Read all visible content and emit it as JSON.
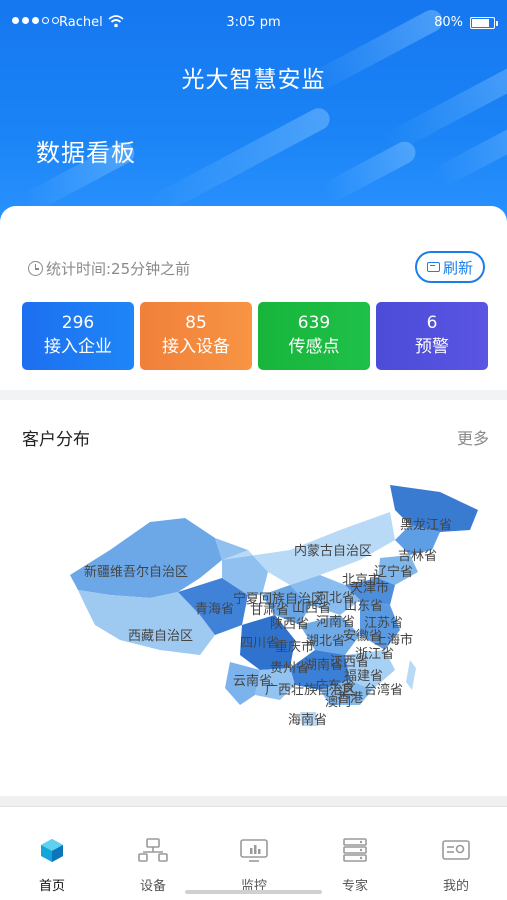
{
  "status_bar": {
    "carrier": "Rachel",
    "time": "3:05 pm",
    "battery": "80%",
    "battery_level": 0.8
  },
  "header": {
    "app_title": "光大智慧安监",
    "dashboard_title": "数据看板"
  },
  "stats": {
    "time_label": "统计时间:25分钟之前",
    "refresh_label": "刷新",
    "tiles": [
      {
        "value": "296",
        "label": "接入企业"
      },
      {
        "value": "85",
        "label": "接入设备"
      },
      {
        "value": "639",
        "label": "传感点"
      },
      {
        "value": "6",
        "label": "预警"
      }
    ]
  },
  "distribution": {
    "title": "客户分布",
    "more": "更多",
    "regions": [
      "黑龙江省",
      "吉林省",
      "辽宁省",
      "内蒙古自治区",
      "新疆维吾尔自治区",
      "宁夏回族自治区",
      "甘肃省",
      "青海省",
      "西藏自治区",
      "四川省",
      "重庆市",
      "贵州省",
      "云南省",
      "广西壮族自治区",
      "海南省",
      "台湾省",
      "湖北省",
      "湖南省",
      "河南省",
      "山东省",
      "北京市",
      "天津市",
      "河北省",
      "陕西省",
      "山西省",
      "安徽省",
      "江苏省",
      "上海市",
      "浙江省",
      "江西省",
      "福建省",
      "广东省",
      "香港",
      "澳门"
    ]
  },
  "tabs": [
    {
      "label": "首页",
      "icon": "home-cube-icon",
      "active": true
    },
    {
      "label": "设备",
      "icon": "device-network-icon"
    },
    {
      "label": "监控",
      "icon": "monitor-icon"
    },
    {
      "label": "专家",
      "icon": "expert-server-icon"
    },
    {
      "label": "我的",
      "icon": "profile-card-icon"
    }
  ]
}
